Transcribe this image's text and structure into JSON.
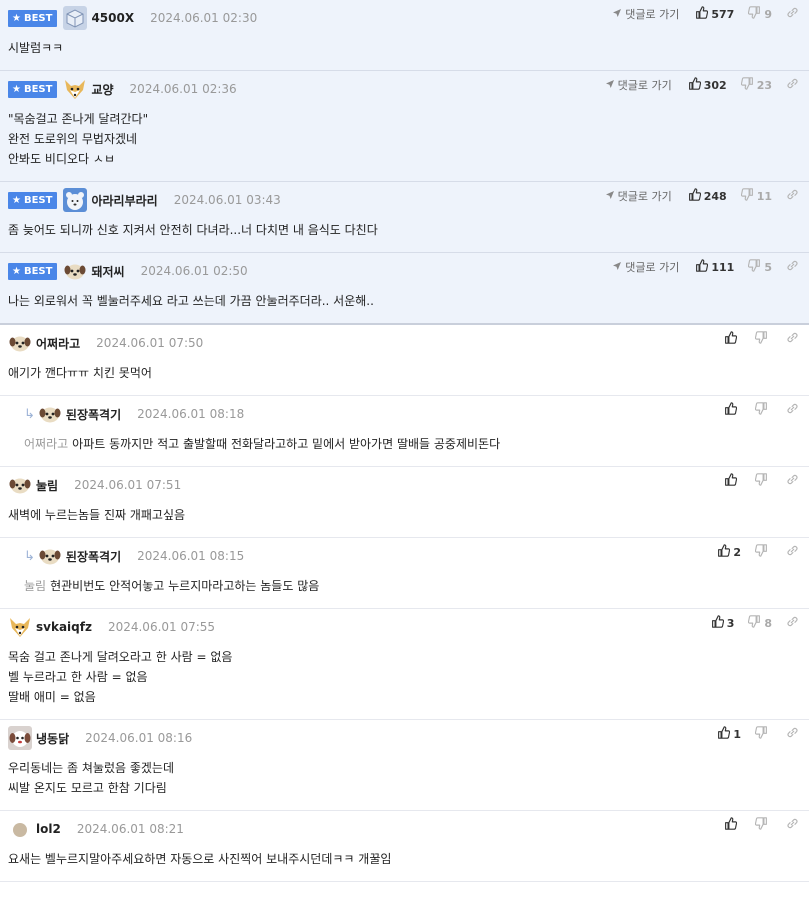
{
  "labels": {
    "best": "BEST",
    "goto": "댓글로 가기"
  },
  "comments": [
    {
      "best": true,
      "avatar": "cube-avatar",
      "nick": "4500X",
      "date": "2024.06.01 02:30",
      "up": "577",
      "down": "9",
      "text": "시발럼ㅋㅋ"
    },
    {
      "best": true,
      "avatar": "fox-avatar",
      "nick": "교양",
      "date": "2024.06.01 02:36",
      "up": "302",
      "down": "23",
      "text": "\"목숨걸고 존나게 달려간다\"\n완전 도로위의 무법자겠네\n안봐도 비디오다 ㅅㅂ"
    },
    {
      "best": true,
      "avatar": "bear-avatar",
      "nick": "아라리부라리",
      "date": "2024.06.01 03:43",
      "up": "248",
      "down": "11",
      "text": "좀 늦어도 되니까 신호 지켜서 안전히 다녀라...너 다치면 내 음식도 다친다"
    },
    {
      "best": true,
      "avatar": "dog-avatar",
      "nick": "돼저씨",
      "date": "2024.06.01 02:50",
      "up": "111",
      "down": "5",
      "text": "나는 외로워서 꼭 벨눌러주세요 라고 쓰는데 가끔 안눌러주더라.. 서운해.."
    },
    {
      "best": false,
      "avatar": "dog-avatar",
      "nick": "어쩌라고",
      "date": "2024.06.01 07:50",
      "up": "",
      "down": "",
      "text": "애기가 깬다ㅠㅠ 치킨 못먹어"
    },
    {
      "best": false,
      "reply": true,
      "avatar": "dog-avatar",
      "nick": "된장폭격기",
      "date": "2024.06.01 08:18",
      "up": "",
      "down": "",
      "mention": "어쩌라고",
      "text": "아파트 동까지만 적고 출발할때 전화달라고하고 밑에서 받아가면 딸배들 공중제비돈다"
    },
    {
      "best": false,
      "avatar": "dog-avatar",
      "nick": "눌림",
      "date": "2024.06.01 07:51",
      "up": "",
      "down": "",
      "text": "새벽에 누르는놈들 진짜 개패고싶음"
    },
    {
      "best": false,
      "reply": true,
      "avatar": "dog-avatar",
      "nick": "된장폭격기",
      "date": "2024.06.01 08:15",
      "up": "2",
      "down": "",
      "mention": "눌림",
      "text": "현관비번도 안적어놓고 누르지마라고하는 놈들도 많음"
    },
    {
      "best": false,
      "avatar": "fox-avatar",
      "nick": "svkaiqfz",
      "date": "2024.06.01 07:55",
      "up": "3",
      "down": "8",
      "text": "목숨 걸고 존나게 달려오라고 한 사람 = 없음\n벨 누르라고 한 사람 = 없음\n딸배 애미 = 없음"
    },
    {
      "best": false,
      "avatar": "puppy-avatar",
      "nick": "냉동닭",
      "date": "2024.06.01 08:16",
      "up": "1",
      "down": "",
      "text": "우리동네는 좀 쳐눌렀음 좋겠는데\n씨발 온지도 모르고 한참 기다림"
    },
    {
      "best": false,
      "avatar": "dot-avatar",
      "nick": "lol2",
      "date": "2024.06.01 08:21",
      "up": "",
      "down": "",
      "text": "요새는 벨누르지말아주세요하면 자동으로 사진찍어 보내주시던데ㅋㅋ 개꿀임"
    }
  ]
}
